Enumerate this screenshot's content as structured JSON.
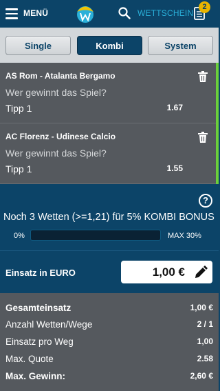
{
  "header": {
    "menu_label": "MENÜ",
    "wettschein_label": "WETTSCHEIN",
    "slip_count": "2"
  },
  "tabs": [
    {
      "label": "Single",
      "active": false
    },
    {
      "label": "Kombi",
      "active": true
    },
    {
      "label": "System",
      "active": false
    }
  ],
  "bets": [
    {
      "match": "AS Rom - Atalanta Bergamo",
      "question": "Wer gewinnt das Spiel?",
      "tip": "Tipp 1",
      "odd": "1.67"
    },
    {
      "match": "AC Florenz - Udinese Calcio",
      "question": "Wer gewinnt das Spiel?",
      "tip": "Tipp 1",
      "odd": "1.55"
    }
  ],
  "bonus": {
    "text": "Noch 3 Wetten (>=1,21) für 5% KOMBI BONUS",
    "progress_min_label": "0%",
    "progress_max_label": "MAX 30%",
    "progress_fraction": 0
  },
  "stake": {
    "label": "Einsatz in EURO",
    "value": "1,00 €"
  },
  "summary": [
    {
      "label": "Gesamteinsatz",
      "value": "1,00 €",
      "bold": true
    },
    {
      "label": "Anzahl Wetten/Wege",
      "value": "2 / 1",
      "bold": false
    },
    {
      "label": "Einsatz pro Weg",
      "value": "1,00",
      "bold": false
    },
    {
      "label": "Max. Quote",
      "value": "2.58",
      "bold": false
    },
    {
      "label": "Max. Gewinn:",
      "value": "2,60 €",
      "bold": true
    }
  ],
  "colors": {
    "brand_dark": "#0c4468",
    "accent": "#2ab0d9",
    "badge": "#e8b400",
    "selection_marker": "#6ccf3a"
  }
}
